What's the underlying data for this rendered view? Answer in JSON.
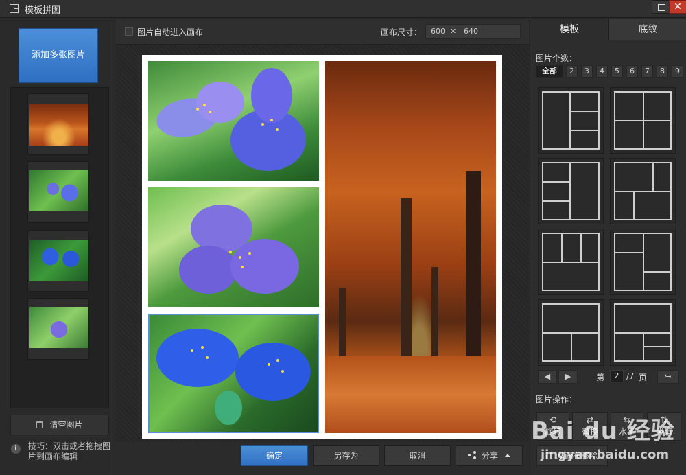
{
  "window": {
    "title": "模板拼图",
    "maximize_icon": "restore-icon",
    "close_glyph": "✕"
  },
  "left_panel": {
    "add_button": "添加多张图片",
    "thumbnails": [
      "autumn-forest",
      "purple-flower-1",
      "blue-flowers",
      "purple-flower-2"
    ],
    "clear_button": "清空图片",
    "tip_icon": "i",
    "tip_text": "技巧：双击或者拖拽图片到画布编辑"
  },
  "toolbar": {
    "auto_enter_label": "图片自动进入画布",
    "auto_enter_checked": false,
    "canvas_size_label": "画布尺寸：",
    "canvas_width": "600",
    "canvas_size_sep": "✕",
    "canvas_height": "640"
  },
  "canvas": {
    "background": "#ffffff",
    "cells": [
      "purple-flowers-top-left",
      "purple-flower-middle-left",
      "blue-flowers-bottom-left",
      "autumn-trees-right"
    ]
  },
  "actions": {
    "confirm": "确定",
    "save_as": "另存为",
    "cancel": "取消",
    "share": "分享"
  },
  "right_panel": {
    "tabs": [
      "模板",
      "底纹"
    ],
    "active_tab": "模板",
    "count_label": "图片个数：",
    "counts": [
      "全部",
      "2",
      "3",
      "4",
      "5",
      "6",
      "7",
      "8",
      "9"
    ],
    "selected_count": "全部",
    "pager": {
      "prefix": "第",
      "current": "2",
      "total": "/7",
      "suffix": "页"
    },
    "ops_label": "图片操作：",
    "ops": [
      "旋转",
      "替换",
      "水平",
      "竖直"
    ],
    "remove_button": "从画布移除"
  },
  "watermark": {
    "line1": "Bai du 经验",
    "line2": "jingyan.baidu.com"
  },
  "colors": {
    "accent": "#3a7fd0",
    "panel": "#2d2d2d",
    "close": "#c43a2a"
  }
}
